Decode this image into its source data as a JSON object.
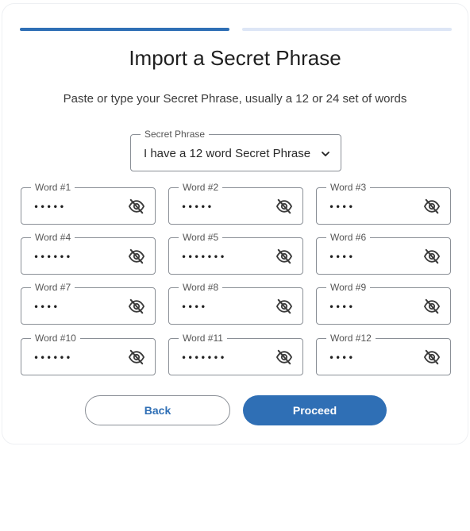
{
  "colors": {
    "primary": "#2f6fb5",
    "progress_active": "#2f6fb5",
    "progress_inactive": "#dde6f6",
    "back_text": "#2f6fb5"
  },
  "progress": {
    "current_step": 1,
    "total_steps": 2
  },
  "title": "Import a Secret Phrase",
  "subtitle": "Paste or type your Secret Phrase, usually a 12 or 24 set of words",
  "phrase_select": {
    "label": "Secret Phrase",
    "value": "I have a 12 word Secret Phrase",
    "icon": "chevron-down-icon"
  },
  "words": [
    {
      "label": "Word #1",
      "masked": "•••••"
    },
    {
      "label": "Word #2",
      "masked": "•••••"
    },
    {
      "label": "Word #3",
      "masked": "••••"
    },
    {
      "label": "Word #4",
      "masked": "••••••"
    },
    {
      "label": "Word #5",
      "masked": "•••••••"
    },
    {
      "label": "Word #6",
      "masked": "••••"
    },
    {
      "label": "Word #7",
      "masked": "••••"
    },
    {
      "label": "Word #8",
      "masked": "••••"
    },
    {
      "label": "Word #9",
      "masked": "••••"
    },
    {
      "label": "Word #10",
      "masked": "••••••"
    },
    {
      "label": "Word #11",
      "masked": "•••••••"
    },
    {
      "label": "Word #12",
      "masked": "••••"
    }
  ],
  "toggle_icon": "eye-off-icon",
  "buttons": {
    "back": "Back",
    "proceed": "Proceed"
  }
}
